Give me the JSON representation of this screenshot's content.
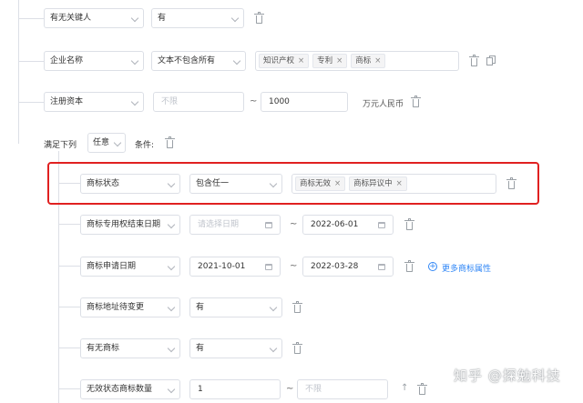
{
  "rows": {
    "has_key_person": {
      "field": "有无关键人",
      "value": "有"
    },
    "company_name": {
      "field": "企业名称",
      "operator": "文本不包含所有",
      "tags": [
        "知识产权",
        "专利",
        "商标"
      ]
    },
    "registered_capital": {
      "field": "注册资本",
      "min_placeholder": "不限",
      "max": "1000",
      "unit": "万元人民币"
    },
    "group": {
      "label_prefix": "满足下列",
      "mode": "任意",
      "label_suffix": "条件:"
    },
    "trademark_status": {
      "field": "商标状态",
      "operator": "包含任一",
      "tags": [
        "商标无效",
        "商标异议中"
      ]
    },
    "exclusive_right_end": {
      "field": "商标专用权结束日期",
      "start_placeholder": "请选择日期",
      "end": "2022-06-01"
    },
    "application_date": {
      "field": "商标申请日期",
      "start": "2021-10-01",
      "end": "2022-03-28",
      "more_link": "更多商标属性"
    },
    "address_pending": {
      "field": "商标地址待变更",
      "value": "有"
    },
    "has_trademark": {
      "field": "有无商标",
      "value": "有"
    },
    "invalid_count": {
      "field": "无效状态商标数量",
      "min": "1",
      "max_placeholder": "不限"
    }
  },
  "tilde": "~",
  "watermark": "知乎 @探勉科技",
  "colors": {
    "highlight": "#e02020",
    "link": "#2f86f6",
    "border": "#dcdfe6"
  }
}
